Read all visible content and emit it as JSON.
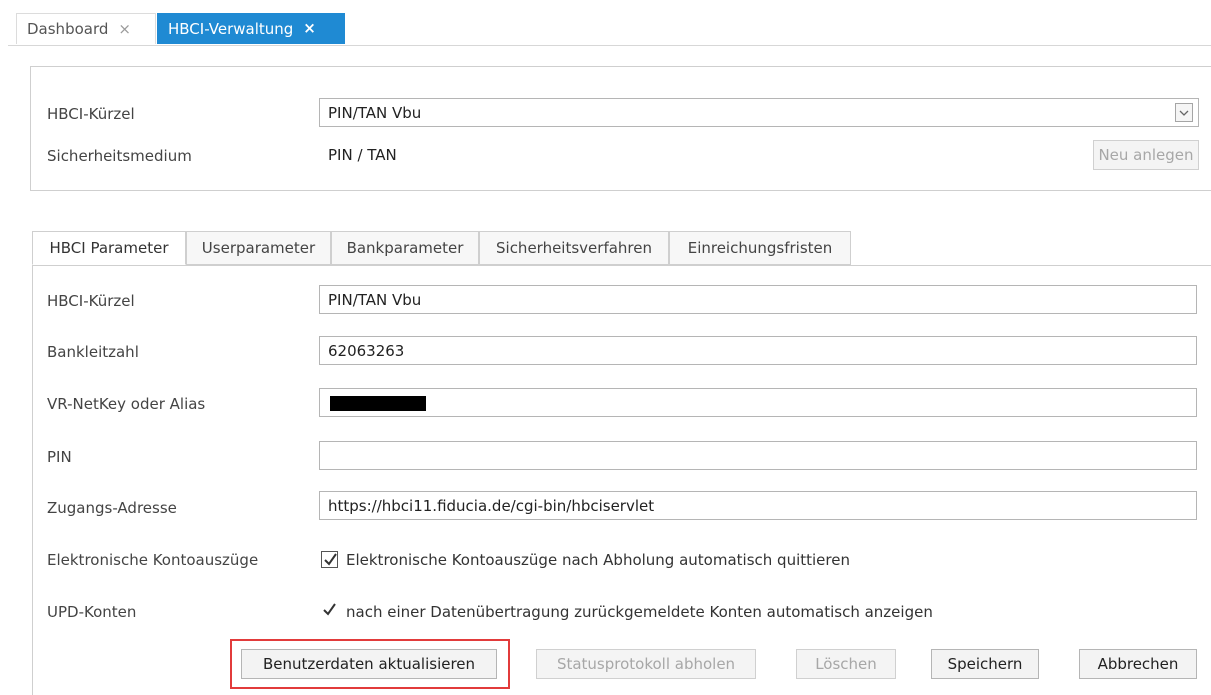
{
  "tabs": {
    "dashboard": "Dashboard",
    "hbci": "HBCI-Verwaltung",
    "close_symbol": "×"
  },
  "top": {
    "kuerzel_label": "HBCI-Kürzel",
    "kuerzel_value": "PIN/TAN Vbu",
    "medium_label": "Sicherheitsmedium",
    "medium_value": "PIN / TAN",
    "new_button": "Neu anlegen"
  },
  "subtabs": [
    "HBCI Parameter",
    "Userparameter",
    "Bankparameter",
    "Sicherheitsverfahren",
    "Einreichungsfristen"
  ],
  "params": {
    "kuerzel_label": "HBCI-Kürzel",
    "kuerzel_value": "PIN/TAN Vbu",
    "blz_label": "Bankleitzahl",
    "blz_value": "62063263",
    "netkey_label": "VR-NetKey oder Alias",
    "pin_label": "PIN",
    "pin_value": "",
    "address_label": "Zugangs-Adresse",
    "address_value": "https://hbci11.fiducia.de/cgi-bin/hbciservlet",
    "statements_label": "Elektronische Kontoauszüge",
    "statements_check": "Elektronische Kontoauszüge nach Abholung automatisch quittieren",
    "upd_label": "UPD-Konten",
    "upd_check": "nach einer Datenübertragung zurückgemeldete Konten automatisch anzeigen"
  },
  "buttons": {
    "update": "Benutzerdaten aktualisieren",
    "status": "Statusprotokoll abholen",
    "delete": "Löschen",
    "save": "Speichern",
    "cancel": "Abbrechen"
  },
  "colors": {
    "accent": "#1f8ad3",
    "highlight": "#e23b3b"
  }
}
